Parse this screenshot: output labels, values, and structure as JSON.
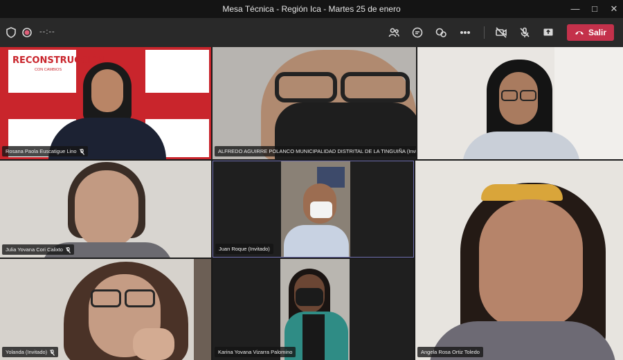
{
  "window": {
    "title": "Mesa Técnica - Región Ica - Martes 25 de enero"
  },
  "toolbar": {
    "timer": "--:--",
    "leave_label": "Salir"
  },
  "banner": {
    "brand": "RECONSTRUCCIÓN",
    "tagline": "CON CAMBIOS"
  },
  "participants": [
    {
      "name": "Rosana Paola Euscatigue Lino"
    },
    {
      "name": "ALFREDO AGUIRRE POLANCO MUNICIPALIDAD DISTRITAL DE LA TINGUIÑA (Invitado)"
    },
    {
      "name": ""
    },
    {
      "name": "Julia Yovana Cori Calixto"
    },
    {
      "name": "Juan Roque (Invitado)"
    },
    {
      "name": "Angela Rosa Ortiz Toledo"
    },
    {
      "name": "Yolanda (Invitado)"
    },
    {
      "name": "Karina Yovana Vizarra Palomino"
    }
  ],
  "colors": {
    "leave": "#c4314b",
    "brand_red": "#c9252c",
    "toolbar_bg": "#292929"
  }
}
